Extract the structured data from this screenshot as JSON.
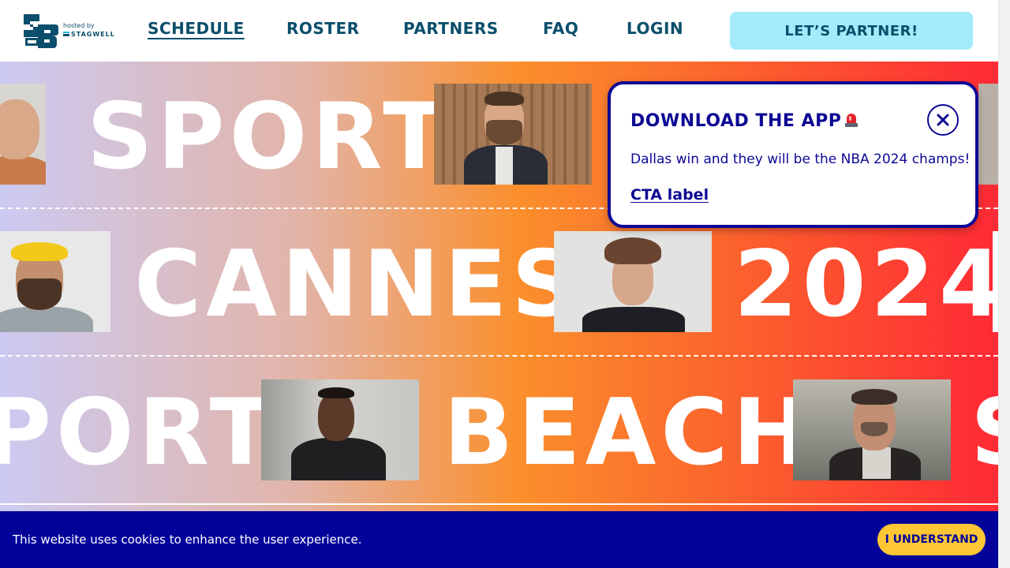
{
  "header": {
    "logo": {
      "mark_text": "SB",
      "hosted_by": "hosted by",
      "host_name": "STAGWELL"
    },
    "nav": [
      {
        "label": "SCHEDULE",
        "active": true
      },
      {
        "label": "ROSTER",
        "active": false
      },
      {
        "label": "PARTNERS",
        "active": false
      },
      {
        "label": "FAQ",
        "active": false
      },
      {
        "label": "LOGIN",
        "active": false
      }
    ],
    "cta_label": "LET’S PARTNER!"
  },
  "hero": {
    "rows": [
      {
        "words": [
          "SPORT"
        ]
      },
      {
        "words": [
          "CANNES",
          "2024"
        ]
      },
      {
        "words": [
          "PORT",
          "BEACH",
          "S"
        ]
      }
    ],
    "photos": [
      "portrait-photo",
      "portrait-photo-suit",
      "portrait-photo-yellow-cap",
      "portrait-photo-curly-hair",
      "portrait-photo-black-shirt",
      "portrait-photo-coat"
    ]
  },
  "popup": {
    "title": "DOWNLOAD THE APP",
    "icon": "siren-icon",
    "body": "Dallas win and they will be the NBA 2024 champs!",
    "cta_label": "CTA label"
  },
  "cookie_banner": {
    "text": "This website uses cookies to enhance the user experience.",
    "button_label": "I UNDERSTAND"
  },
  "colors": {
    "brand_dark": "#0b4f6c",
    "cta_bg": "#a3ebfb",
    "popup_navy": "#0d0894",
    "cookie_bg": "#03039a",
    "cookie_button": "#fec634",
    "hero_gradient": [
      "#cccaf2",
      "#e2b4a8",
      "#fb8f2c",
      "#ff2a35"
    ]
  }
}
